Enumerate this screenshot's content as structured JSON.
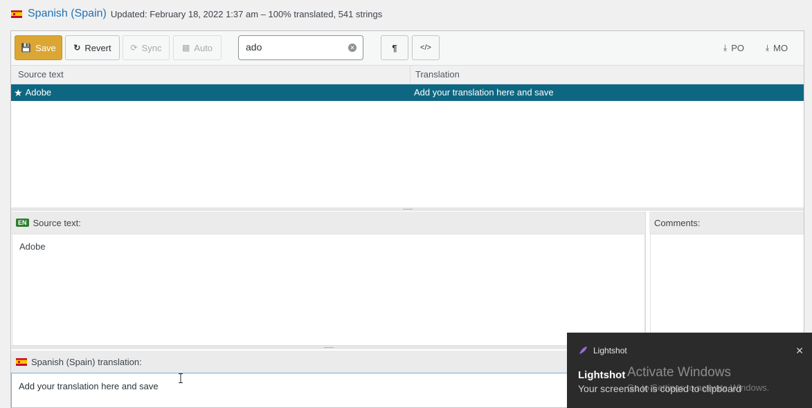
{
  "header": {
    "locale_name": "Spanish (Spain)",
    "meta": "Updated: February 18, 2022 1:37 am – 100% translated, 541 strings"
  },
  "toolbar": {
    "save_label": "Save",
    "revert_label": "Revert",
    "sync_label": "Sync",
    "auto_label": "Auto",
    "search_value": "ado",
    "pilcrow_label": "¶",
    "code_label": "</>",
    "po_label": "PO",
    "mo_label": "MO"
  },
  "grid": {
    "columns": [
      "Source text",
      "Translation"
    ],
    "rows": [
      {
        "source": "Adobe",
        "translation": "Add your translation here and save",
        "starred": true,
        "selected": true
      }
    ]
  },
  "source_panel": {
    "badge": "EN",
    "title": "Source text:",
    "text": "Adobe"
  },
  "comments_panel": {
    "title": "Comments:"
  },
  "translation_panel": {
    "title": "Spanish (Spain) translation:",
    "placeholder": "Add your translation here and save"
  },
  "toast": {
    "app": "Lightshot",
    "title": "Lightshot",
    "message": "Your screenshot is copied to clipboard"
  },
  "watermark": {
    "line1": "Activate Windows",
    "line2": "Go to Settings to activate Windows."
  },
  "colors": {
    "accent": "#2271b1",
    "selected_row": "#0e6782",
    "save_button": "#dba633",
    "toast_bg": "#2b2b2b"
  }
}
